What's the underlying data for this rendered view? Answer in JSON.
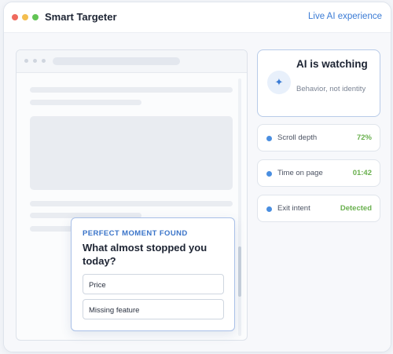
{
  "window": {
    "title": "Smart Targeter",
    "link": "Live AI experience"
  },
  "popup": {
    "kicker": "PERFECT MOMENT FOUND",
    "question": "What almost stopped you today?",
    "options": [
      "Price",
      "Missing feature"
    ]
  },
  "ai_card": {
    "icon": "sparkle-icon",
    "title": "AI is watching",
    "subtitle": "Behavior, not identity"
  },
  "metrics": [
    {
      "label": "Scroll depth",
      "value": "72%"
    },
    {
      "label": "Time on page",
      "value": "01:42"
    },
    {
      "label": "Exit intent",
      "value": "Detected"
    }
  ],
  "colors": {
    "accent": "#3a7bd5",
    "success": "#69b04e"
  }
}
